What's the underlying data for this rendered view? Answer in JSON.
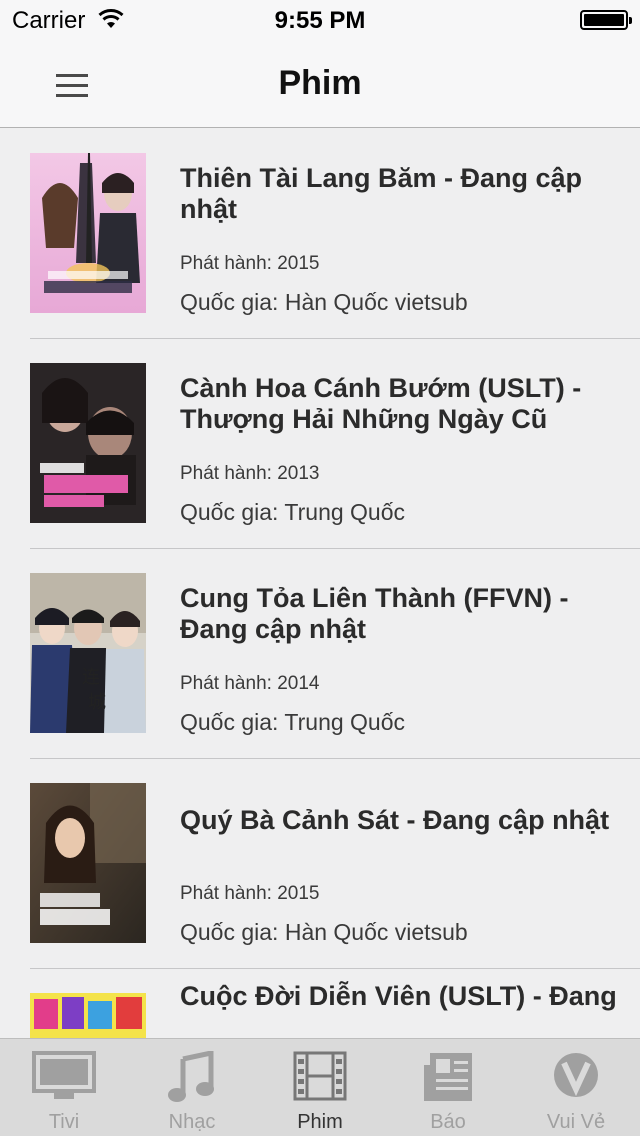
{
  "status_bar": {
    "carrier": "Carrier",
    "time": "9:55 PM"
  },
  "nav": {
    "title": "Phim"
  },
  "movies": [
    {
      "title": "Thiên Tài Lang Băm - Đang cập nhật",
      "release": "Phát hành: 2015",
      "country": "Quốc gia: Hàn Quốc vietsub"
    },
    {
      "title": "Cành Hoa Cánh Bướm (USLT) - Thượng Hải Những Ngày Cũ",
      "release": "Phát hành: 2013",
      "country": "Quốc gia: Trung Quốc"
    },
    {
      "title": "Cung Tỏa Liên Thành (FFVN) - Đang cập nhật",
      "release": "Phát hành: 2014",
      "country": "Quốc gia: Trung Quốc"
    },
    {
      "title": "Quý Bà Cảnh Sát - Đang cập nhật",
      "release": "Phát hành: 2015",
      "country": "Quốc gia: Hàn Quốc vietsub"
    },
    {
      "title": "Cuộc Đời Diễn Viên (USLT) - Đang",
      "release": "",
      "country": ""
    }
  ],
  "tabs": [
    {
      "label": "Tivi",
      "icon": "tv-icon"
    },
    {
      "label": "Nhạc",
      "icon": "music-note-icon"
    },
    {
      "label": "Phim",
      "icon": "film-strip-icon",
      "active": true
    },
    {
      "label": "Báo",
      "icon": "newspaper-icon"
    },
    {
      "label": "Vui Vẻ",
      "icon": "v-logo-icon"
    }
  ],
  "colors": {
    "tab_active": "#333333",
    "tab_inactive": "#a0a0a0",
    "background": "#efeff0"
  }
}
